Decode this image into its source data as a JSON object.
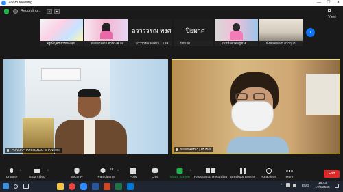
{
  "window": {
    "title": "Zoom Meeting",
    "minimize": "—",
    "maximize": "☐",
    "close": "✕"
  },
  "meeting_bar": {
    "recording_label": "Recording...",
    "pause_glyph": "⏸",
    "stop_glyph": "■",
    "view_label": "View"
  },
  "thumbnails": [
    {
      "name": "ครูเพ็ญศรี  ธารทองสุข..."
    },
    {
      "name": "ผังดี  หนทาย  ดำนางค์  อส..."
    },
    {
      "name": "ลววววรณ  พงศาว... (เอส...",
      "overlay": "ลววววรณ  พงศาว..."
    },
    {
      "name": "ปิยมาศ",
      "overlay": "ปิยมาศ"
    },
    {
      "name": "ไม่มีชื่อตัวตนผู้ช่วย..."
    },
    {
      "name": "ทั้งหมดของมี  ดาวกุมฯ"
    }
  ],
  "next_page_glyph": "›",
  "video_tiles": [
    {
      "name": "PUNNAPHATCHANAU CHANHOM"
    },
    {
      "name": "ของเกษตรันฯ | ศรีโรงสี"
    }
  ],
  "toolbar": {
    "unmute": "Unmute",
    "stop_video": "Stop Video",
    "security": "Security",
    "participants": "Participants",
    "participants_count": "91",
    "polls": "Polls",
    "chat": "Chat",
    "share_screen": "Share Screen",
    "pause_stop_recording": "Pause/Stop Recording",
    "breakout_rooms": "Breakout Rooms",
    "reactions": "Reactions",
    "more": "More",
    "end": "End"
  },
  "taskbar": {
    "lang": "ENG",
    "time": "15:43",
    "date": "17/2/2565"
  },
  "colors": {
    "accent_blue": "#0e72ed",
    "end_red": "#e02828",
    "active_speaker": "#f0e15a",
    "share_green": "#22b14c"
  }
}
